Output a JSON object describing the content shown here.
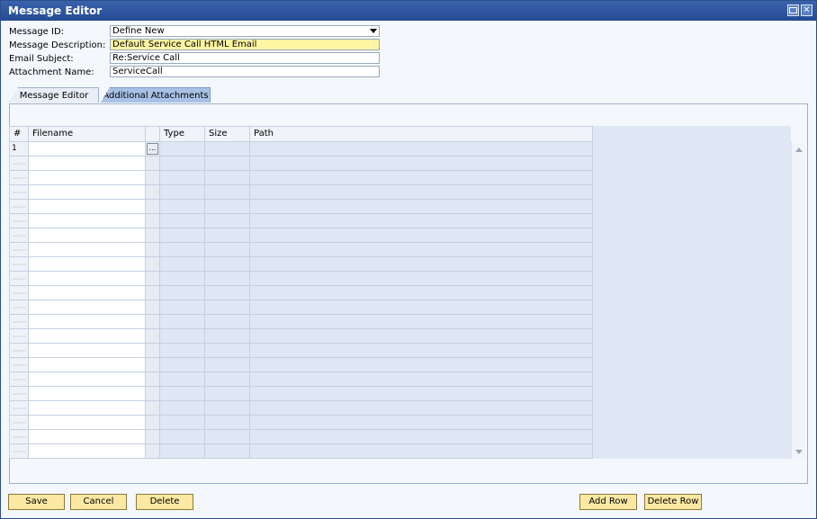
{
  "window": {
    "title": "Message Editor"
  },
  "form": {
    "message_id": {
      "label": "Message ID:",
      "value": "Define New"
    },
    "message_description": {
      "label": "Message Description:",
      "value": "Default Service Call HTML Email"
    },
    "email_subject": {
      "label": "Email Subject:",
      "value": "Re:Service Call"
    },
    "attachment_name": {
      "label": "Attachment Name:",
      "value": "ServiceCall"
    }
  },
  "tabs": [
    {
      "label": "Message Editor",
      "active": false
    },
    {
      "label": "Additional Attachments",
      "active": true
    }
  ],
  "grid": {
    "columns": [
      "#",
      "Filename",
      "",
      "Type",
      "Size",
      "Path"
    ],
    "row_numbers": [
      "1"
    ],
    "row_count": 22,
    "browse_label": "..."
  },
  "buttons": {
    "save": "Save",
    "cancel": "Cancel",
    "delete": "Delete",
    "add_row": "Add Row",
    "delete_row": "Delete Row"
  },
  "colors": {
    "title_bar": "#254a92",
    "button_face": "#fbe8a3",
    "highlight_field": "#fff5a3",
    "grid_readonly": "#dfe6f4"
  }
}
